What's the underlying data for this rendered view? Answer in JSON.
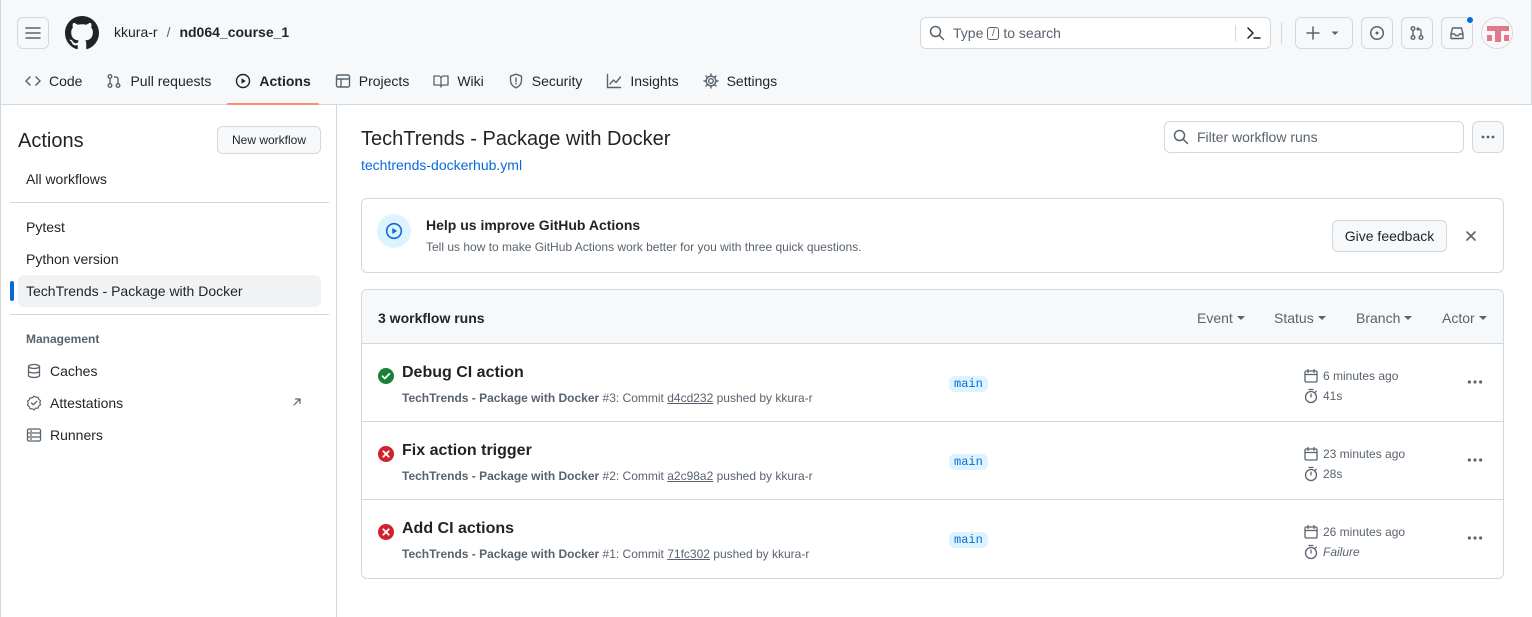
{
  "header": {
    "owner": "kkura-r",
    "separator": "/",
    "repo": "nd064_course_1",
    "search": {
      "prefix": "Type",
      "key": "/",
      "suffix": "to search"
    },
    "icons": [
      "hamburger-icon",
      "github-logo",
      "search-icon",
      "command-palette-icon",
      "plus-icon",
      "issues-icon",
      "pull-request-icon",
      "inbox-icon",
      "avatar"
    ]
  },
  "tabs": [
    {
      "label": "Code",
      "icon": "code-icon"
    },
    {
      "label": "Pull requests",
      "icon": "pull-request-icon"
    },
    {
      "label": "Actions",
      "icon": "play-icon",
      "active": true
    },
    {
      "label": "Projects",
      "icon": "table-icon"
    },
    {
      "label": "Wiki",
      "icon": "book-icon"
    },
    {
      "label": "Security",
      "icon": "shield-icon"
    },
    {
      "label": "Insights",
      "icon": "graph-icon"
    },
    {
      "label": "Settings",
      "icon": "gear-icon"
    }
  ],
  "sidebar": {
    "title": "Actions",
    "new_workflow": "New workflow",
    "all_workflows": "All workflows",
    "workflows": [
      "Pytest",
      "Python version",
      "TechTrends - Package with Docker"
    ],
    "management_heading": "Management",
    "management": [
      "Caches",
      "Attestations",
      "Runners"
    ]
  },
  "main": {
    "title": "TechTrends - Package with Docker",
    "file_link": "techtrends-dockerhub.yml",
    "filter_placeholder": "Filter workflow runs",
    "banner": {
      "title": "Help us improve GitHub Actions",
      "description": "Tell us how to make GitHub Actions work better for you with three quick questions.",
      "button": "Give feedback"
    },
    "runs_header": {
      "count": "3 workflow runs",
      "filters": [
        "Event",
        "Status",
        "Branch",
        "Actor"
      ]
    },
    "runs": [
      {
        "status": "success",
        "title": "Debug CI action",
        "workflow": "TechTrends - Package with Docker",
        "number": "#3",
        "commit_label": ": Commit",
        "sha": "d4cd232",
        "pushed_by": "pushed by kkura-r",
        "branch": "main",
        "time": "6 minutes ago",
        "duration": "41s"
      },
      {
        "status": "failure",
        "title": "Fix action trigger",
        "workflow": "TechTrends - Package with Docker",
        "number": "#2",
        "commit_label": ": Commit",
        "sha": "a2c98a2",
        "pushed_by": "pushed by kkura-r",
        "branch": "main",
        "time": "23 minutes ago",
        "duration": "28s"
      },
      {
        "status": "failure",
        "title": "Add CI actions",
        "workflow": "TechTrends - Package with Docker",
        "number": "#1",
        "commit_label": ": Commit",
        "sha": "71fc302",
        "pushed_by": "pushed by kkura-r",
        "branch": "main",
        "time": "26 minutes ago",
        "duration": "Failure"
      }
    ]
  },
  "colors": {
    "accent": "#0969da",
    "success": "#1a7f37",
    "danger": "#cf222e",
    "tab_underline": "#fd8c73",
    "border": "#d1d9e0",
    "muted": "#59636e"
  }
}
